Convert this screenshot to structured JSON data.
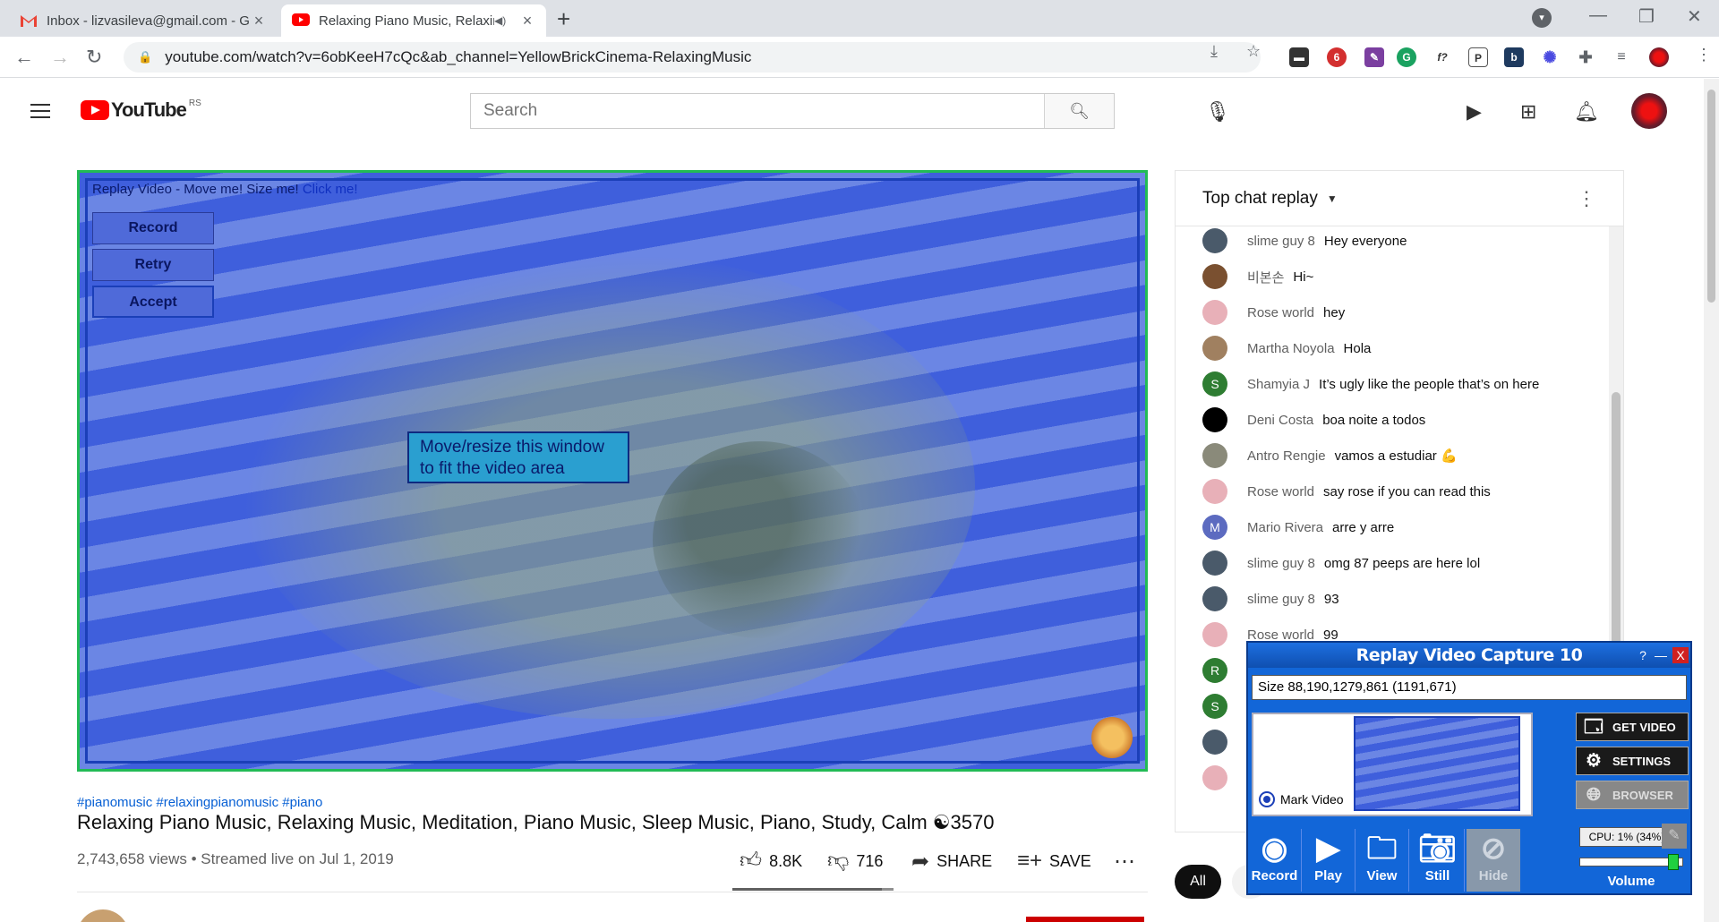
{
  "browser": {
    "tabs": [
      {
        "title": "Inbox - lizvasileva@gmail.com - G",
        "active": false
      },
      {
        "title": "Relaxing Piano Music, Relaxin",
        "active": true
      }
    ],
    "new_tab": "+",
    "url": "youtube.com/watch?v=6obKeeH7cQc&ab_channel=YellowBrickCinema-RelaxingMusic",
    "gmail_badge": "6",
    "ext_badge": "6"
  },
  "youtube": {
    "logo_text": "YouTube",
    "region": "RS",
    "search_placeholder": "Search"
  },
  "overlay": {
    "title_prefix": "Replay Video - Move me! Size me! ",
    "title_click": "Click me!",
    "buttons": [
      "Record",
      "Retry",
      "Accept"
    ],
    "fit_hint_line1": "Move/resize this window",
    "fit_hint_line2": "to fit the video area"
  },
  "video": {
    "hashtags": "#pianomusic #relaxingpianomusic #piano",
    "title": "Relaxing Piano Music, Relaxing Music, Meditation, Piano Music, Sleep Music, Piano, Study, Calm ☯3570",
    "views": "2,743,658 views",
    "streamed": "Streamed live on Jul 1, 2019",
    "likes": "8.8K",
    "dislikes": "716",
    "share": "SHARE",
    "save": "SAVE",
    "like_ratio": 0.925
  },
  "chat": {
    "header": "Top chat replay",
    "messages": [
      {
        "author": "slime guy 8",
        "text": "Hey everyone",
        "avatar_color": "#4a5a6a",
        "initial": ""
      },
      {
        "author": "비본손",
        "text": "Hi~",
        "avatar_color": "#7a5030",
        "initial": ""
      },
      {
        "author": "Rose world",
        "text": "hey",
        "avatar_color": "#e8b0b8",
        "initial": ""
      },
      {
        "author": "Martha Noyola",
        "text": "Hola",
        "avatar_color": "#a08060",
        "initial": ""
      },
      {
        "author": "Shamyia J",
        "text": "It’s ugly like the people that’s on here",
        "avatar_color": "#2e7d32",
        "initial": "S"
      },
      {
        "author": "Deni Costa",
        "text": "boa noite a todos",
        "avatar_color": "#000000",
        "initial": ""
      },
      {
        "author": "Antro Rengie",
        "text": "vamos a estudiar 💪",
        "avatar_color": "#8a8a7a",
        "initial": ""
      },
      {
        "author": "Rose world",
        "text": "say rose if you can read this",
        "avatar_color": "#e8b0b8",
        "initial": ""
      },
      {
        "author": "Mario Rivera",
        "text": "arre y arre",
        "avatar_color": "#5c6bc0",
        "initial": "M"
      },
      {
        "author": "slime guy 8",
        "text": "omg 87 peeps are here lol",
        "avatar_color": "#4a5a6a",
        "initial": ""
      },
      {
        "author": "slime guy 8",
        "text": "93",
        "avatar_color": "#4a5a6a",
        "initial": ""
      },
      {
        "author": "Rose world",
        "text": "99",
        "avatar_color": "#e8b0b8",
        "initial": ""
      },
      {
        "author": "",
        "text": "",
        "avatar_color": "#2e7d32",
        "initial": "R"
      },
      {
        "author": "",
        "text": "",
        "avatar_color": "#2e7d32",
        "initial": "S"
      },
      {
        "author": "",
        "text": "",
        "avatar_color": "#4a5a6a",
        "initial": ""
      },
      {
        "author": "",
        "text": "",
        "avatar_color": "#e8b0b8",
        "initial": ""
      }
    ],
    "chip_all": "All"
  },
  "capture": {
    "title": "Replay Video Capture 10",
    "help": "?",
    "minimize": "—",
    "close": "X",
    "size_text": "Size 88,190,1279,861 (1191,671)",
    "mark_video": "Mark Video",
    "get_video": "GET VIDEO",
    "settings": "SETTINGS",
    "browser": "BROWSER",
    "cpu": "CPU: 1% (34%)",
    "volume": "Volume",
    "volume_level": 0.94,
    "record": "Record",
    "play": "Play",
    "view": "View",
    "still": "Still",
    "hide": "Hide"
  },
  "colors": {
    "youtube_red": "#ff0000",
    "overlay_blue": "#4f6ad9",
    "capture_blue": "#1266d8",
    "link_blue": "#065fd4"
  }
}
